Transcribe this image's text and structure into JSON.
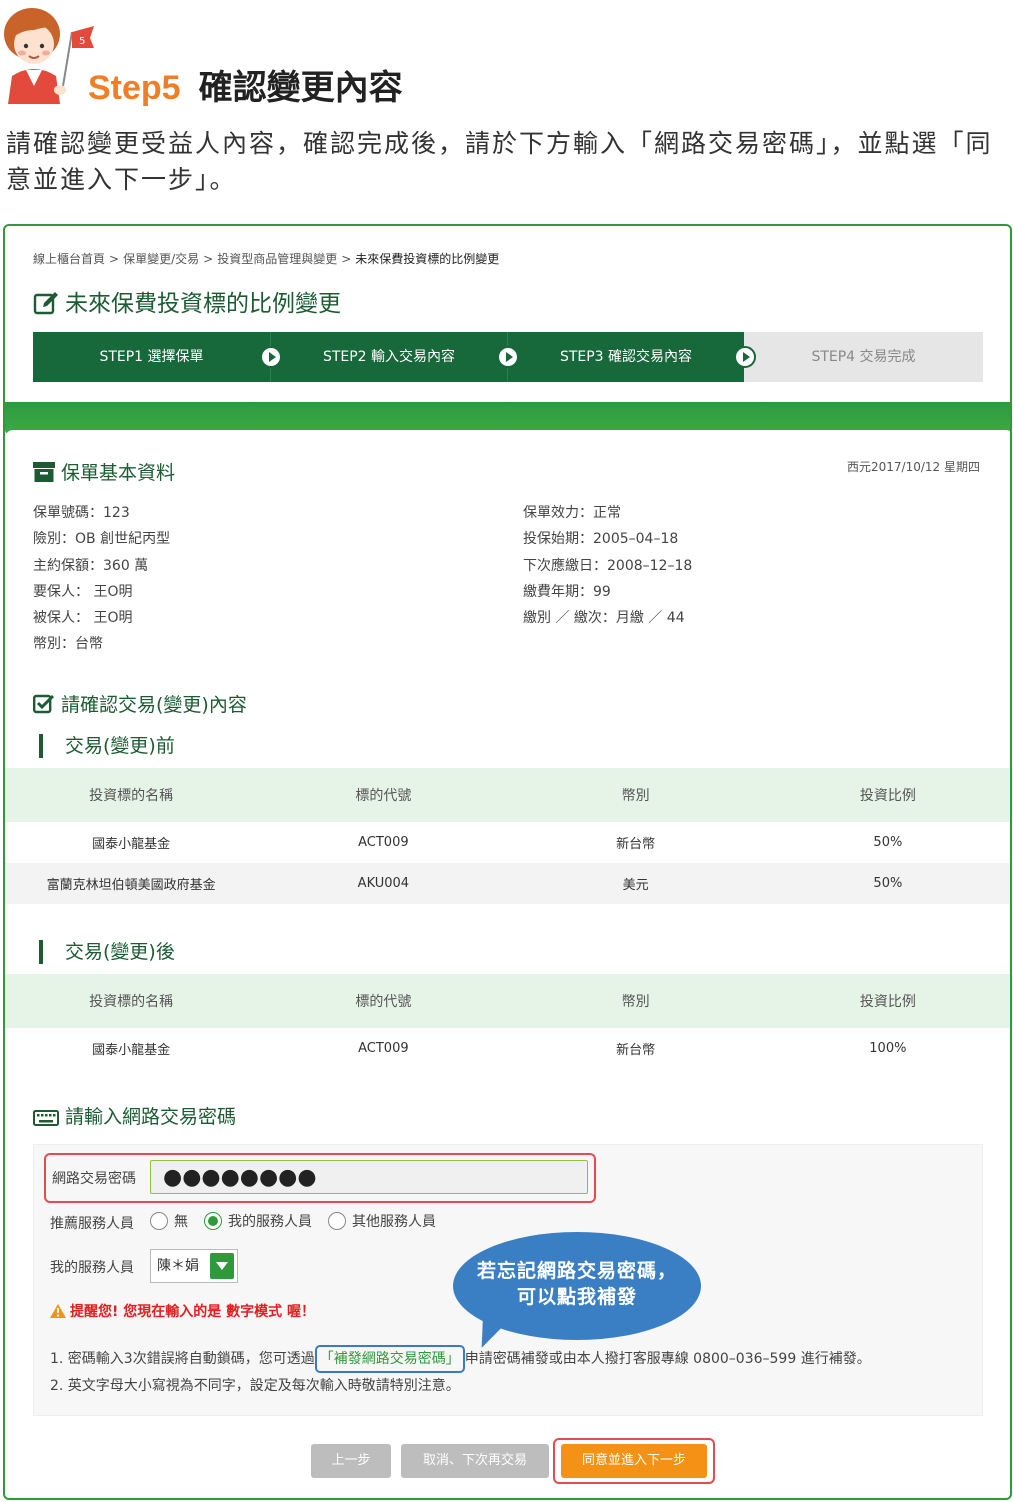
{
  "header": {
    "step_no": "Step5",
    "step_title": "確認變更內容",
    "intro": "請確認變更受益人內容，確認完成後，請於下方輸入「網路交易密碼」，並點選「同意並進入下一步」。",
    "flag_number": "5"
  },
  "breadcrumb": {
    "items": [
      "線上櫃台首頁",
      "保單變更/交易",
      "投資型商品管理與變更"
    ],
    "current": "未來保費投資標的比例變更",
    "separator": ">"
  },
  "page_title": "未來保費投資標的比例變更",
  "steps": [
    {
      "label": "STEP1 選擇保單",
      "state": "done"
    },
    {
      "label": "STEP2 輸入交易內容",
      "state": "done"
    },
    {
      "label": "STEP3 確認交易內容",
      "state": "current"
    },
    {
      "label": "STEP4 交易完成",
      "state": "pending"
    }
  ],
  "policy": {
    "section_title": "保單基本資料",
    "date": "西元2017/10/12 星期四",
    "left": [
      "保單號碼：123",
      "險別：OB 創世紀丙型",
      "主約保額：360 萬",
      "要保人： 王O明",
      "被保人： 王O明",
      "幣別：台幣"
    ],
    "right": [
      "保單效力：正常",
      "投保始期：2005–04–18",
      "下次應繳日：2008–12–18",
      "繳費年期：99",
      "繳別 ／ 繳次：月繳 ／ 44"
    ]
  },
  "confirm": {
    "section_title": "請確認交易(變更)內容",
    "before_title": "交易(變更)前",
    "after_title": "交易(變更)後",
    "columns": [
      "投資標的名稱",
      "標的代號",
      "幣別",
      "投資比例"
    ],
    "before_rows": [
      [
        "國泰小龍基金",
        "ACT009",
        "新台幣",
        "50%"
      ],
      [
        "富蘭克林坦伯頓美國政府基金",
        "AKU004",
        "美元",
        "50%"
      ]
    ],
    "after_rows": [
      [
        "國泰小龍基金",
        "ACT009",
        "新台幣",
        "100%"
      ]
    ]
  },
  "password": {
    "section_title": "請輸入網路交易密碼",
    "label": "網路交易密碼",
    "value": "●●●●●●●●",
    "referrer_label": "推薦服務人員",
    "radio_options": [
      {
        "label": "無",
        "checked": false
      },
      {
        "label": "我的服務人員",
        "checked": true
      },
      {
        "label": "其他服務人員",
        "checked": false
      }
    ],
    "agent_label": "我的服務人員",
    "agent_value": "陳＊娟",
    "warning": "提醒您! 您現在輸入的是 數字模式 喔！",
    "note1_before": "1. 密碼輸入3次錯誤將自動鎖碼，您可透過",
    "note1_link": "「補發網路交易密碼」",
    "note1_after": "申請密碼補發或由本人撥打客服專線 0800–036–599 進行補發。",
    "note2": "2. 英文字母大小寫視為不同字，設定及每次輸入時敬請特別注意。"
  },
  "bubble": {
    "line1": "若忘記網路交易密碼，",
    "line2": "可以點我補發"
  },
  "buttons": {
    "prev": "上一步",
    "cancel": "取消、下次再交易",
    "next": "同意並進入下一步"
  },
  "colors": {
    "accent_orange": "#f07e26",
    "brand_green": "#17683b",
    "border_green": "#2e9a3c",
    "highlight_red": "#e54c4c",
    "bubble_blue": "#3a7ec4",
    "next_button": "#f39214"
  }
}
